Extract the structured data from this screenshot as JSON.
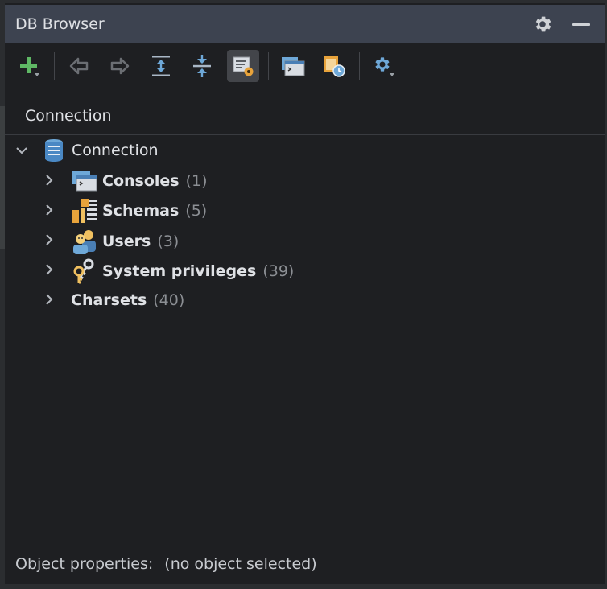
{
  "panel": {
    "title": "DB Browser"
  },
  "tab": {
    "label": "Connection"
  },
  "tree": {
    "root": {
      "label": "Connection"
    },
    "children": [
      {
        "label": "Consoles",
        "count": "(1)"
      },
      {
        "label": "Schemas",
        "count": "(5)"
      },
      {
        "label": "Users",
        "count": "(3)"
      },
      {
        "label": "System privileges",
        "count": "(39)"
      },
      {
        "label": "Charsets",
        "count": "(40)"
      }
    ]
  },
  "status": {
    "label": "Object properties:",
    "value": "(no object selected)"
  },
  "colors": {
    "titlebar": "#3d4350",
    "background": "#1e1f22",
    "add_green": "#5fb865",
    "icon_blue": "#6ea8d8",
    "icon_orange": "#e8a33b"
  }
}
